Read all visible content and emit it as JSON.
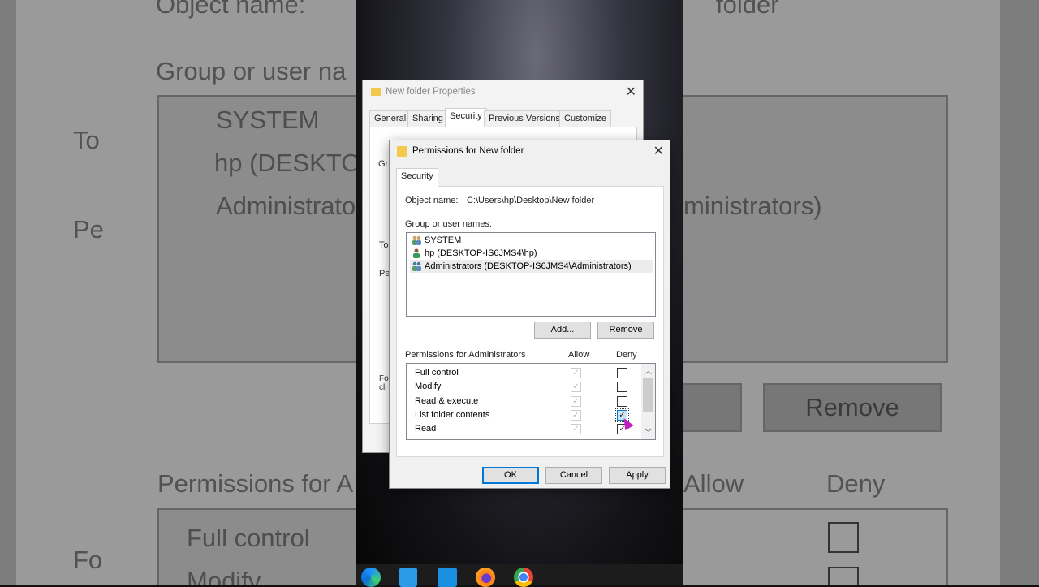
{
  "background_left": {
    "object_name": "Object name:",
    "group_label": "Group or user na",
    "users": [
      "SYSTEM",
      "hp (DESKTO",
      "Administrato"
    ],
    "to": "To",
    "pe": "Pe",
    "perm_label": "Permissions for A",
    "full_control": "Full control",
    "modify": "Modify",
    "fo": "Fo"
  },
  "background_right": {
    "folder": "folder",
    "admins": "ministrators)",
    "remove": "Remove",
    "allow": "Allow",
    "deny": "Deny"
  },
  "properties_dialog": {
    "title": "New folder Properties",
    "tabs": [
      "General",
      "Sharing",
      "Security",
      "Previous Versions",
      "Customize"
    ],
    "active_tab": "Security",
    "fragments": [
      "Gr",
      "To",
      "Pe",
      "Fo",
      "cli"
    ]
  },
  "permissions_dialog": {
    "title": "Permissions for New folder",
    "tab": "Security",
    "object_name_label": "Object name:",
    "object_name": "C:\\Users\\hp\\Desktop\\New folder",
    "group_label": "Group or user names:",
    "users": [
      {
        "name": "SYSTEM",
        "icon": "group-icon"
      },
      {
        "name": "hp (DESKTOP-IS6JMS4\\hp)",
        "icon": "user-icon"
      },
      {
        "name": "Administrators (DESKTOP-IS6JMS4\\Administrators)",
        "icon": "group-icon",
        "selected": true
      }
    ],
    "add_button": "Add...",
    "remove_button": "Remove",
    "permissions_label": "Permissions for Administrators",
    "allow_header": "Allow",
    "deny_header": "Deny",
    "permissions": [
      {
        "name": "Full control",
        "allow": true,
        "deny": false
      },
      {
        "name": "Modify",
        "allow": true,
        "deny": false
      },
      {
        "name": "Read & execute",
        "allow": true,
        "deny": false
      },
      {
        "name": "List folder contents",
        "allow": true,
        "deny": true
      },
      {
        "name": "Read",
        "allow": true,
        "deny": true
      }
    ],
    "ok": "OK",
    "cancel": "Cancel",
    "apply": "Apply",
    "check_glyph": "✓"
  },
  "taskbar": [
    "edge-icon",
    "store-icon",
    "mail-icon",
    "firefox-icon",
    "chrome-icon"
  ]
}
